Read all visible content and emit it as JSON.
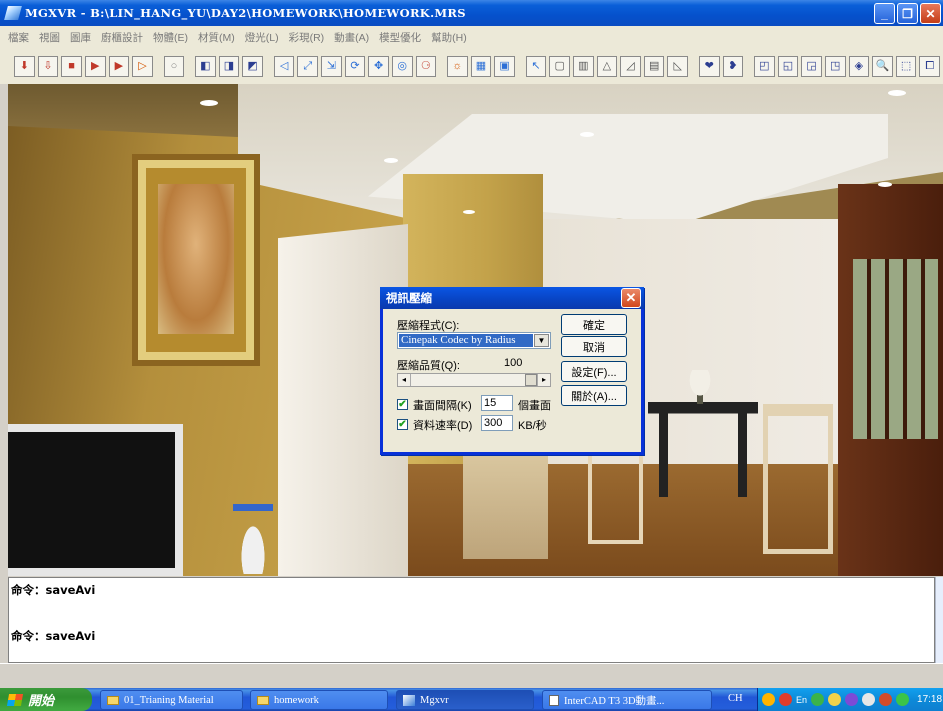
{
  "window": {
    "title": "MGXVR - B:\\LIN_HANG_YU\\DAY2\\HOMEWORK\\HOMEWORK.MRS",
    "minimize": "_",
    "maximize": "❐",
    "close": "✕"
  },
  "menu": [
    "檔案",
    "視圖",
    "圖庫",
    "廚櫃設計",
    "物體(E)",
    "材質(M)",
    "燈光(L)",
    "彩現(R)",
    "動畫(A)",
    "模型優化",
    "幫助(H)"
  ],
  "toolbar": {
    "icons": [
      "import-icon",
      "export-icon",
      "stop-icon",
      "record-icon",
      "play-icon",
      "play-forward-icon",
      "circle-icon",
      "cube-view-1-icon",
      "cube-view-2-icon",
      "cube-view-3-icon",
      "path-icon",
      "zoom-fit-icon",
      "move-icon",
      "rotate-icon",
      "pan-icon",
      "orbit-icon",
      "walk-icon",
      "light-icon",
      "render-icon",
      "render-window-icon",
      "select-icon",
      "box-icon",
      "cylinder-icon",
      "cone-icon",
      "triangle-icon",
      "building-icon",
      "slope-icon",
      "heart-icon",
      "heart-alt-icon",
      "cube-a-icon",
      "cube-b-icon",
      "cube-c-icon",
      "cube-d-icon",
      "cube-e-icon",
      "zoom-icon",
      "frame-icon",
      "window-icon"
    ],
    "glyphs": [
      "⬇",
      "⇩",
      "■",
      "▶",
      "▶",
      "▷",
      "○",
      "◧",
      "◨",
      "◩",
      "◁",
      "⤢",
      "⇲",
      "⟳",
      "✥",
      "◎",
      "⚆",
      "☼",
      "▦",
      "▣",
      "↖",
      "▢",
      "▥",
      "△",
      "◿",
      "▤",
      "◺",
      "❤",
      "❥",
      "◰",
      "◱",
      "◲",
      "◳",
      "◈",
      "🔍",
      "⬚",
      "⧠"
    ],
    "colors": [
      "#c0392b",
      "#c0392b",
      "#c0392b",
      "#c0392b",
      "#c0392b",
      "#d35400",
      "#888888",
      "#2c3e91",
      "#2c3e91",
      "#2c3e91",
      "#2c6fd6",
      "#2c6fd6",
      "#2c6fd6",
      "#2c6fd6",
      "#2c6fd6",
      "#2c6fd6",
      "#c0392b",
      "#d35400",
      "#2c6fd6",
      "#2c6fd6",
      "#2c6fd6",
      "#555555",
      "#555555",
      "#555555",
      "#555555",
      "#555555",
      "#555555",
      "#2c3e91",
      "#2c3e91",
      "#2c3e91",
      "#2c3e91",
      "#2c3e91",
      "#2c3e91",
      "#2c3e91",
      "#2c3e91",
      "#2c3e91",
      "#2c3e91"
    ]
  },
  "dialog": {
    "title": "視訊壓縮",
    "close": "✕",
    "compressor_label": "壓縮程式(C):",
    "compressor_value": "Cinepak Codec by Radius",
    "quality_label": "壓縮品質(Q):",
    "quality_value": "100",
    "quality_level": 1.0,
    "keyframe_label": "畫面間隔(K)",
    "keyframe_value": "15",
    "keyframe_unit": "個畫面",
    "keyframe_checked": true,
    "datarate_label": "資料速率(D)",
    "datarate_value": "300",
    "datarate_unit": "KB/秒",
    "datarate_checked": true,
    "ok": "確定",
    "cancel": "取消",
    "configure": "設定(F)...",
    "about": "關於(A)..."
  },
  "command": {
    "lines": [
      "命令：saveAvi",
      "命令：saveAvi"
    ]
  },
  "taskbar": {
    "start": "開始",
    "tasks": [
      "01_Trianing Material",
      "homework",
      "Mgxvr",
      "InterCAD T3 3D動畫..."
    ],
    "lang": "CH",
    "ime": "En",
    "clock": "17:18"
  }
}
